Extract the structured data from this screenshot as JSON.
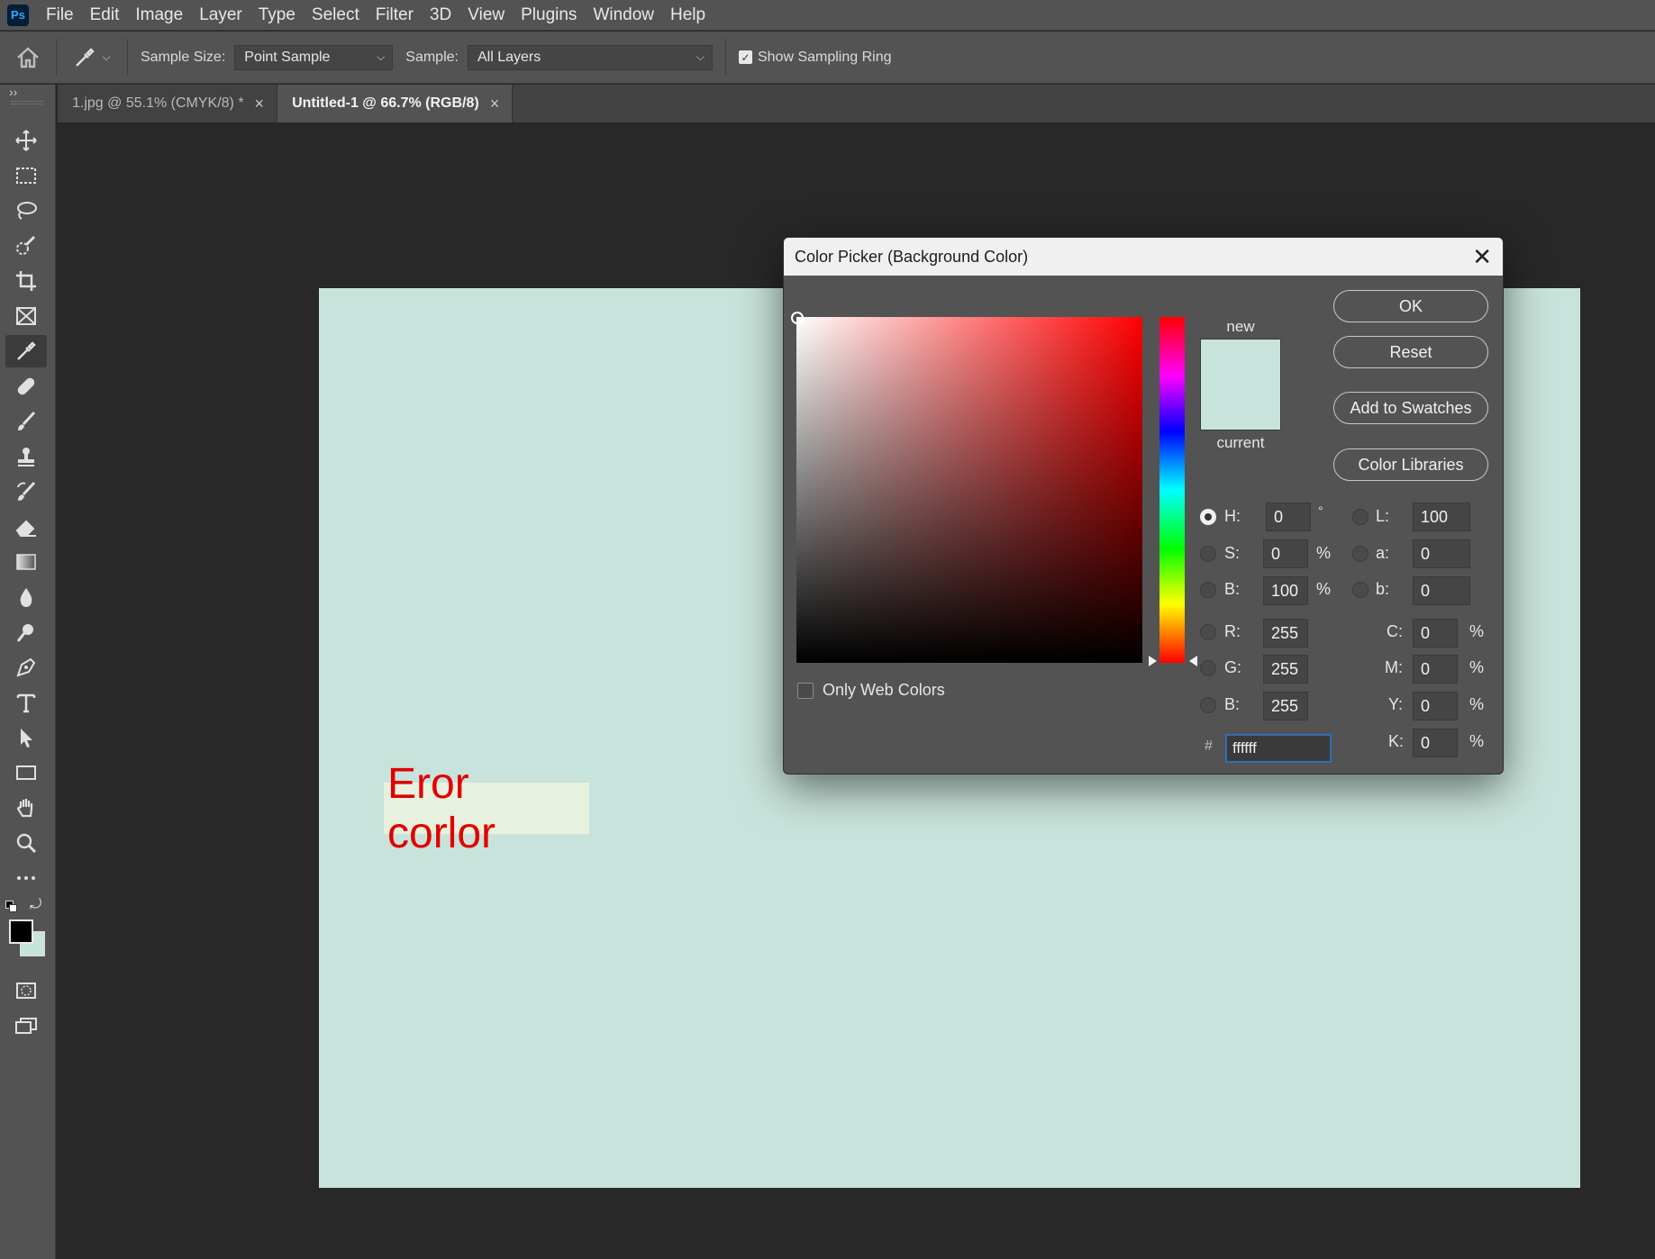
{
  "app": {
    "logo": "Ps"
  },
  "menu": [
    "File",
    "Edit",
    "Image",
    "Layer",
    "Type",
    "Select",
    "Filter",
    "3D",
    "View",
    "Plugins",
    "Window",
    "Help"
  ],
  "options": {
    "sample_size_label": "Sample Size:",
    "sample_size_value": "Point Sample",
    "sample_label": "Sample:",
    "sample_value": "All Layers",
    "show_ring_label": "Show Sampling Ring",
    "show_ring_checked": true
  },
  "panel_toggle": "››",
  "tabs": [
    {
      "label": "1.jpg @ 55.1% (CMYK/8) *",
      "active": false
    },
    {
      "label": "Untitled-1 @ 66.7% (RGB/8)",
      "active": true
    }
  ],
  "tab_close": "×",
  "tools": [
    "move-icon",
    "marquee-icon",
    "lasso-icon",
    "quick-select-icon",
    "crop-icon",
    "frame-icon",
    "eyedropper-icon",
    "healing-icon",
    "brush-icon",
    "stamp-icon",
    "history-brush-icon",
    "eraser-icon",
    "gradient-icon",
    "blur-icon",
    "dodge-icon",
    "pen-icon",
    "type-icon",
    "path-select-icon",
    "rectangle-icon",
    "hand-icon",
    "zoom-icon",
    "more-tools-icon"
  ],
  "colors": {
    "foreground": "#000000",
    "background": "#c8e3db",
    "canvas": "#c8e3db",
    "text_color": "#e10000",
    "text_bg": "#e8f1dd"
  },
  "canvas": {
    "text": "Eror corlor"
  },
  "dialog": {
    "title": "Color Picker (Background Color)",
    "close": "✕",
    "new_label": "new",
    "current_label": "current",
    "buttons": {
      "ok": "OK",
      "reset": "Reset",
      "add": "Add to Swatches",
      "libraries": "Color Libraries"
    },
    "only_web_colors": "Only Web Colors",
    "fields": {
      "h": {
        "label": "H:",
        "value": "0",
        "unit": "°"
      },
      "s": {
        "label": "S:",
        "value": "0",
        "unit": "%"
      },
      "b": {
        "label": "B:",
        "value": "100",
        "unit": "%"
      },
      "r": {
        "label": "R:",
        "value": "255"
      },
      "g": {
        "label": "G:",
        "value": "255"
      },
      "b2": {
        "label": "B:",
        "value": "255"
      },
      "l": {
        "label": "L:",
        "value": "100"
      },
      "a": {
        "label": "a:",
        "value": "0"
      },
      "lb": {
        "label": "b:",
        "value": "0"
      },
      "c": {
        "label": "C:",
        "value": "0",
        "unit": "%"
      },
      "m": {
        "label": "M:",
        "value": "0",
        "unit": "%"
      },
      "y": {
        "label": "Y:",
        "value": "0",
        "unit": "%"
      },
      "k": {
        "label": "K:",
        "value": "0",
        "unit": "%"
      }
    },
    "hex_label": "#",
    "hex_value": "ffffff"
  }
}
